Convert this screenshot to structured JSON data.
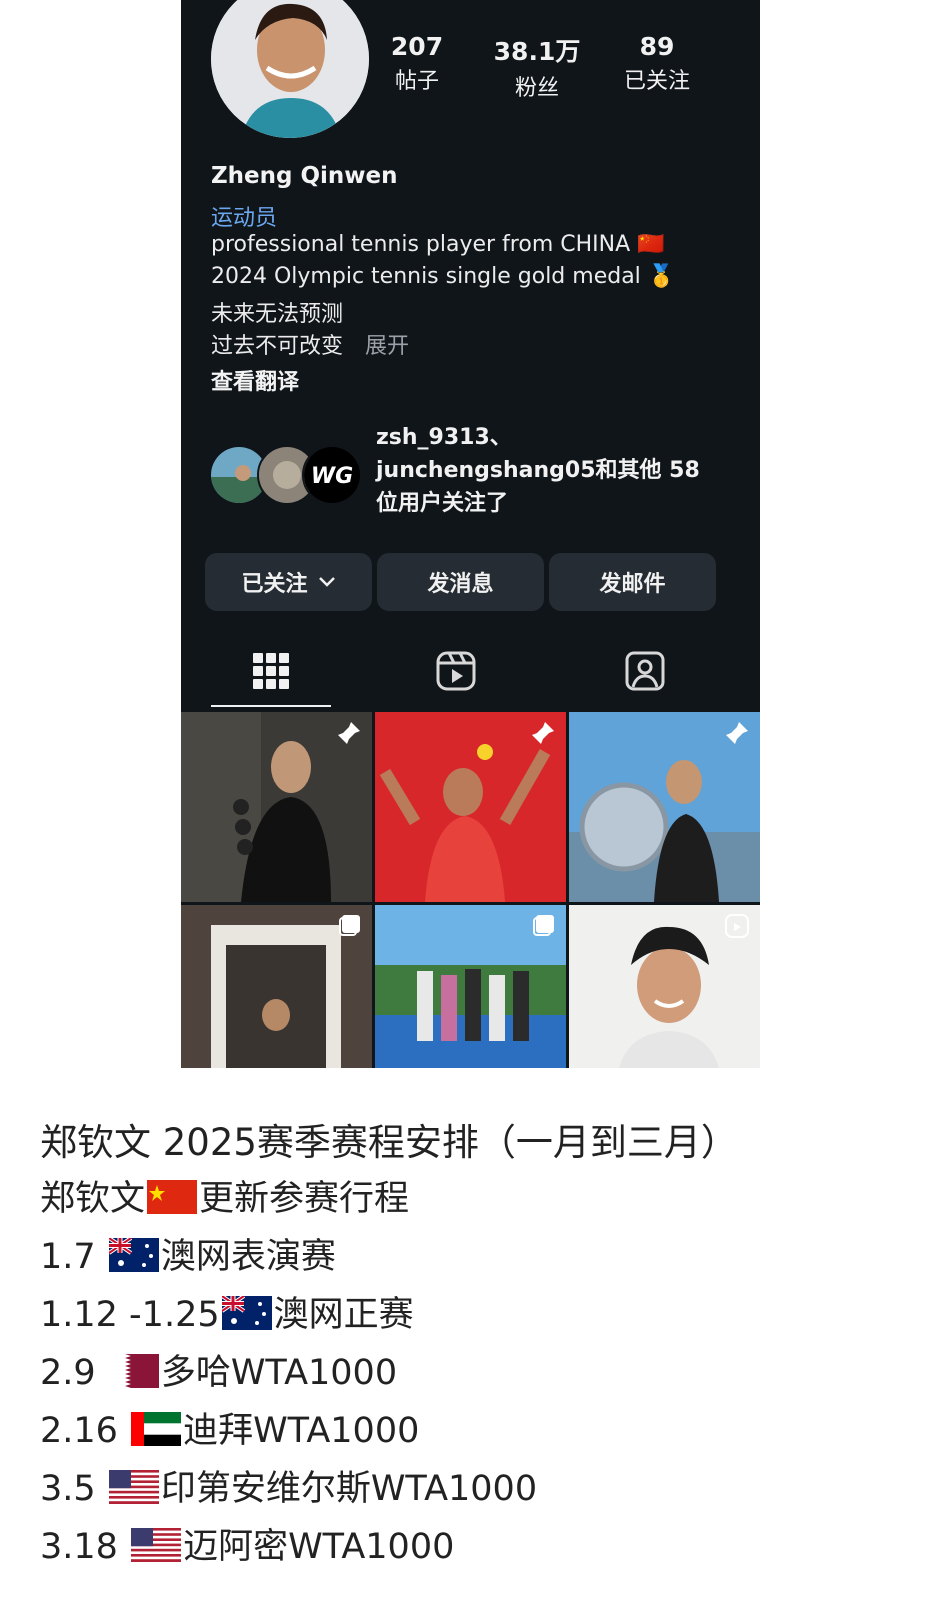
{
  "profile": {
    "stats": [
      {
        "value": "207",
        "label": "帖子"
      },
      {
        "value": "38.1万",
        "label": "粉丝"
      },
      {
        "value": "89",
        "label": "已关注"
      }
    ],
    "name": "Zheng Qinwen",
    "category": "运动员",
    "bio_lines": [
      "professional tennis player from CHINA 🇨🇳",
      "2024 Olympic tennis single gold medal 🥇",
      "未来无法预测",
      "过去不可改变"
    ],
    "expand_label": "展开",
    "translate_label": "查看翻译",
    "followed_by": [
      "zsh_9313、",
      "junchengshang05和其他 58",
      "位用户关注了"
    ],
    "buttons": {
      "following": "已关注",
      "message": "发消息",
      "email": "发邮件"
    },
    "tab_icons": [
      "grid-icon",
      "reels-icon",
      "tagged-icon"
    ]
  },
  "post": {
    "title": "郑钦文 2025赛季赛程安排（一月到三月）",
    "intro_before": "郑钦文",
    "intro_after": "更新参赛行程",
    "schedule": [
      {
        "date": "1.7",
        "event": "澳网表演赛",
        "flag": "australia-flag"
      },
      {
        "date": "1.12 -1.25",
        "event": "澳网正赛",
        "flag": "australia-flag"
      },
      {
        "date": "2.9",
        "event": "多哈WTA1000",
        "flag": "qatar-flag"
      },
      {
        "date": "2.16",
        "event": "迪拜WTA1000",
        "flag": "uae-flag"
      },
      {
        "date": "3.5",
        "event": "印第安维尔斯WTA1000",
        "flag": "usa-flag"
      },
      {
        "date": "3.18",
        "event": "迈阿密WTA1000",
        "flag": "usa-flag"
      }
    ]
  },
  "colors": {
    "app_bg": "#10151a",
    "link_blue": "#6aa7ee",
    "button_bg": "#262c33"
  }
}
